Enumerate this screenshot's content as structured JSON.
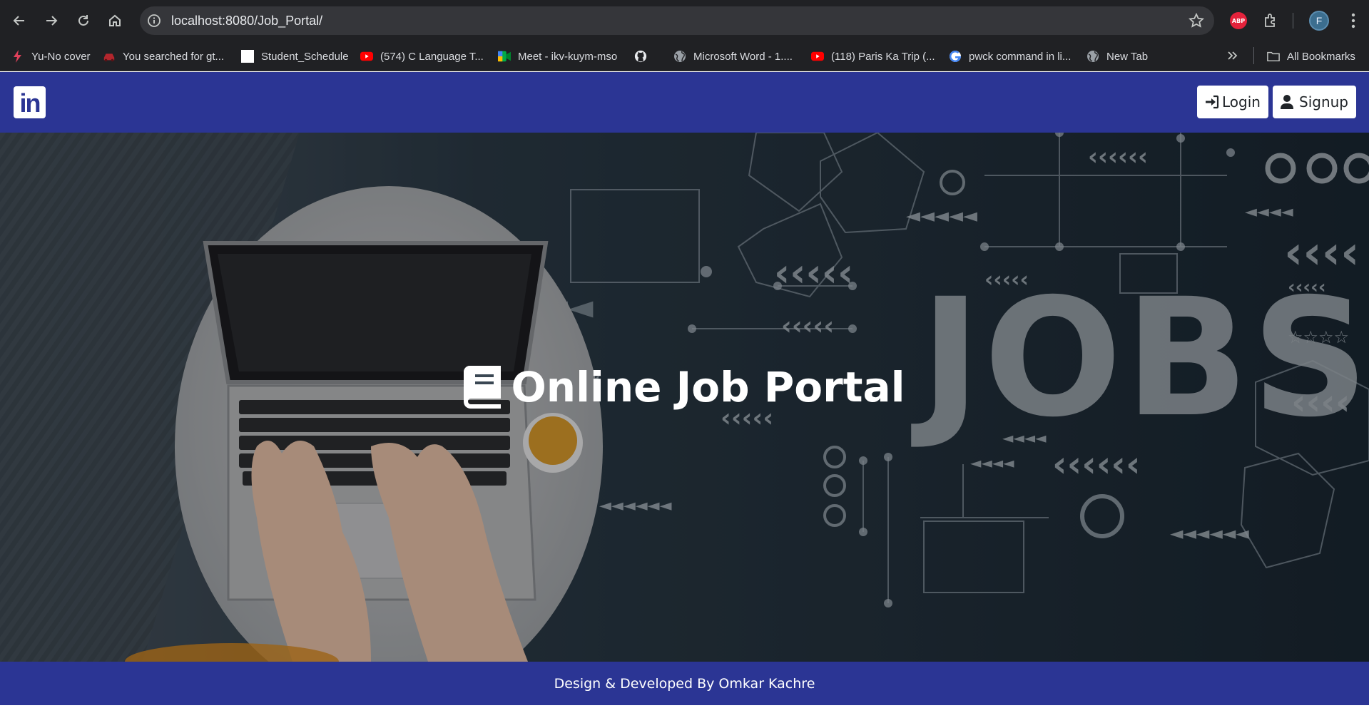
{
  "browser": {
    "url": "localhost:8080/Job_Portal/",
    "avatar_initial": "F",
    "abp_label": "ABP",
    "bookmarks": [
      {
        "label": "Yu-No cover",
        "icon": "lightning-icon"
      },
      {
        "label": "You searched for gt...",
        "icon": "car-icon"
      },
      {
        "label": "Student_Schedule",
        "icon": "blank-page-icon"
      },
      {
        "label": "(574) C Language T...",
        "icon": "youtube-icon"
      },
      {
        "label": "Meet - ikv-kuym-mso",
        "icon": "meet-icon"
      },
      {
        "label": "",
        "icon": "github-icon"
      },
      {
        "label": "Microsoft Word - 1....",
        "icon": "globe-icon"
      },
      {
        "label": "(118) Paris Ka Trip (...",
        "icon": "youtube-icon"
      },
      {
        "label": "pwck command in li...",
        "icon": "google-icon"
      },
      {
        "label": "New Tab",
        "icon": "globe-icon"
      }
    ],
    "all_bookmarks_label": "All Bookmarks"
  },
  "navbar": {
    "logo_text": "in",
    "login_label": "Login",
    "signup_label": "Signup"
  },
  "hero": {
    "title": "Online Job Portal",
    "watermark": "JOBS"
  },
  "footer": {
    "text": "Design & Developed By Omkar Kachre"
  },
  "colors": {
    "brand": "#2b3594",
    "chrome": "#202124"
  }
}
